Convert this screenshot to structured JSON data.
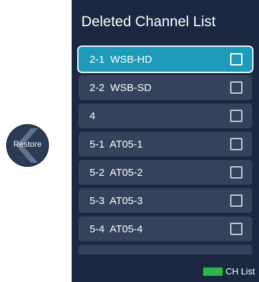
{
  "restore": {
    "label": "Restore",
    "icon": "chevron-left-icon"
  },
  "panel": {
    "title": "Deleted Channel List",
    "channels": [
      {
        "label": "2-1  WSB-HD",
        "checked": false,
        "selected": true
      },
      {
        "label": "2-2  WSB-SD",
        "checked": false,
        "selected": false
      },
      {
        "label": "4",
        "checked": false,
        "selected": false
      },
      {
        "label": "5-1  AT05-1",
        "checked": false,
        "selected": false
      },
      {
        "label": "5-2  AT05-2",
        "checked": false,
        "selected": false
      },
      {
        "label": "5-3  AT05-3",
        "checked": false,
        "selected": false
      },
      {
        "label": "5-4  AT05-4",
        "checked": false,
        "selected": false
      }
    ]
  },
  "footer": {
    "key_color": "#2db84b",
    "label": "CH List"
  },
  "colors": {
    "panel_bg": "#1b2841",
    "item_bg": "#35425c",
    "selected_bg": "#1d9bb8"
  }
}
